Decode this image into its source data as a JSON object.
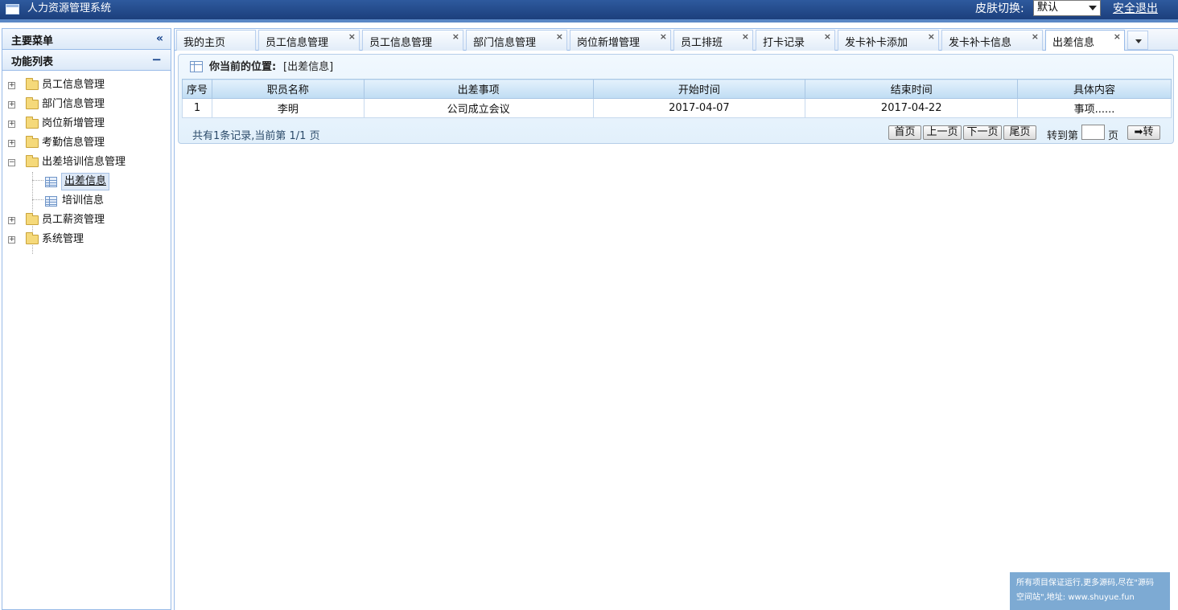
{
  "header": {
    "app_title": "人力资源管理系统",
    "skin_label": "皮肤切换:",
    "skin_selected": "默认",
    "logout_label": "安全退出"
  },
  "sidebar": {
    "main_menu_title": "主要菜单",
    "function_list_title": "功能列表",
    "items": [
      {
        "label": "员工信息管理",
        "expanded": false
      },
      {
        "label": "部门信息管理",
        "expanded": false
      },
      {
        "label": "岗位新增管理",
        "expanded": false
      },
      {
        "label": "考勤信息管理",
        "expanded": false
      },
      {
        "label": "出差培训信息管理",
        "expanded": true,
        "children": [
          {
            "label": "出差信息",
            "selected": true
          },
          {
            "label": "培训信息",
            "selected": false
          }
        ]
      },
      {
        "label": "员工薪资管理",
        "expanded": false
      },
      {
        "label": "系统管理",
        "expanded": false
      }
    ]
  },
  "tabs": [
    {
      "label": "我的主页",
      "closable": false
    },
    {
      "label": "员工信息管理",
      "closable": true
    },
    {
      "label": "员工信息管理",
      "closable": true
    },
    {
      "label": "部门信息管理",
      "closable": true
    },
    {
      "label": "岗位新增管理",
      "closable": true
    },
    {
      "label": "员工排班",
      "closable": true
    },
    {
      "label": "打卡记录",
      "closable": true
    },
    {
      "label": "发卡补卡添加",
      "closable": true
    },
    {
      "label": "发卡补卡信息",
      "closable": true
    },
    {
      "label": "出差信息",
      "closable": true,
      "active": true
    }
  ],
  "close_glyph": "×",
  "content": {
    "location_label": "你当前的位置:",
    "location_value": "[出差信息]",
    "table": {
      "columns": [
        "序号",
        "职员名称",
        "出差事项",
        "开始时间",
        "结束时间",
        "具体内容"
      ],
      "rows": [
        [
          "1",
          "李明",
          "公司成立会议",
          "2017-04-07",
          "2017-04-22",
          "事项......"
        ]
      ]
    },
    "pager": {
      "info": "共有1条记录,当前第 1/1 页",
      "first": "首页",
      "prev": "上一页",
      "next": "下一页",
      "last": "尾页",
      "goto_prefix": "转到第",
      "goto_suffix": "页",
      "goto_value": "",
      "go_button": "➡转"
    }
  },
  "notice": {
    "line1": "所有项目保证运行,更多源码,尽在\"源码",
    "line2": "空间站\",地址: www.shuyue.fun"
  },
  "colors": {
    "header_bg": "#1c3f7c",
    "panel_border": "#99bbe8",
    "notice_bg": "#7daad3"
  }
}
